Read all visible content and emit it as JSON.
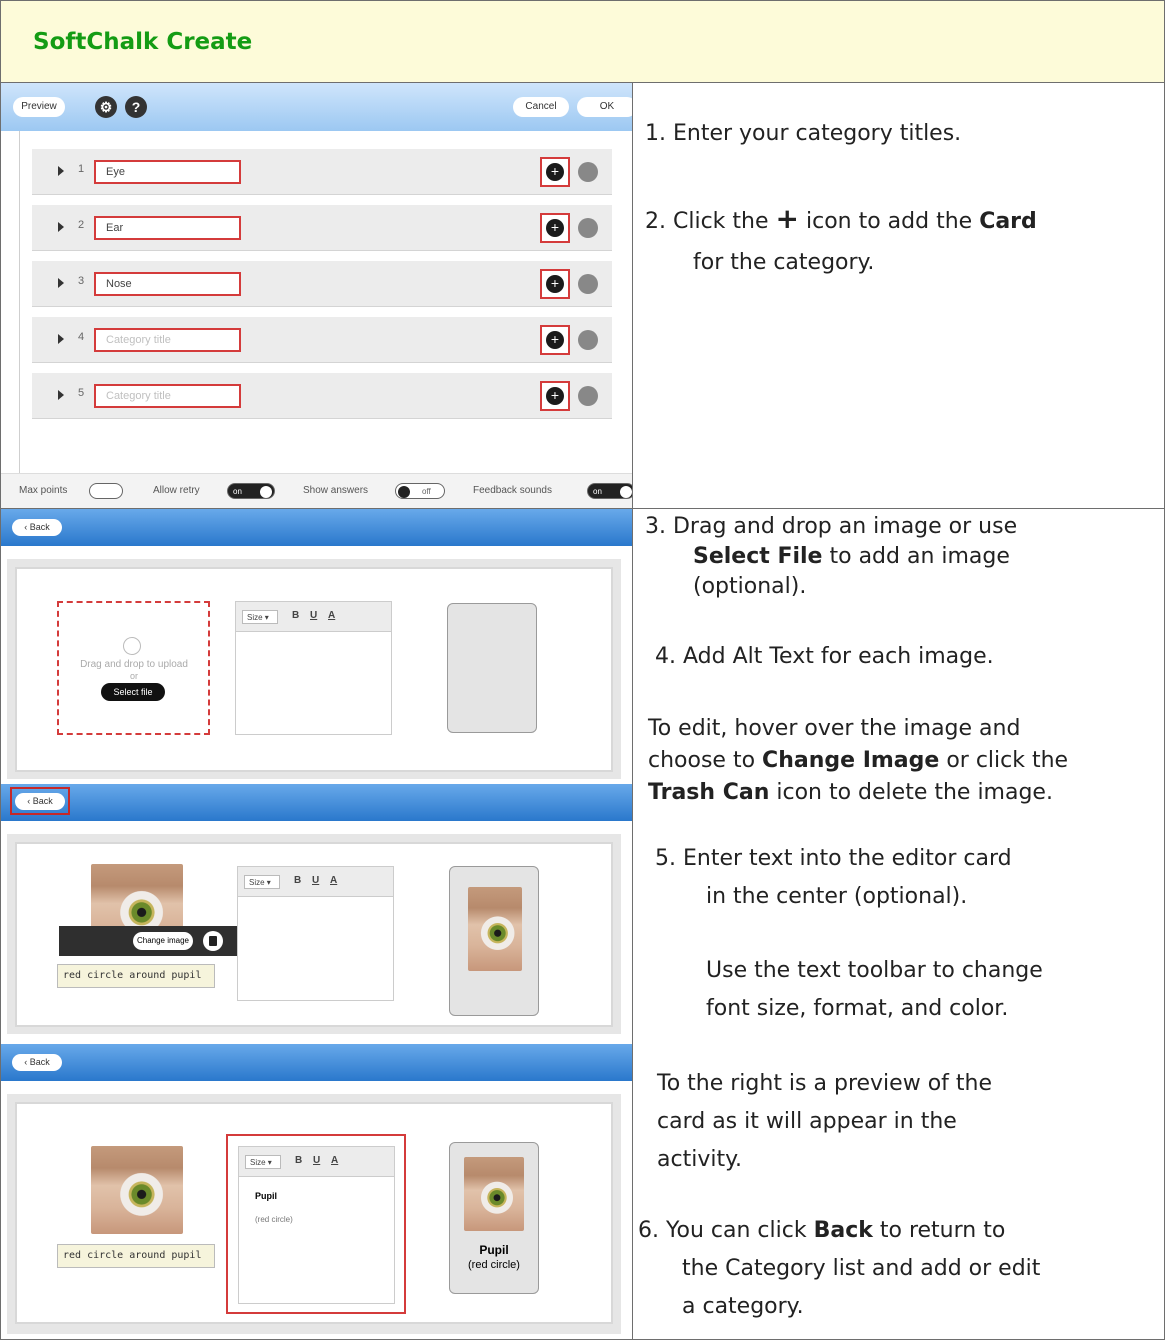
{
  "header": {
    "title": "SoftChalk Create"
  },
  "screen1": {
    "preview_label": "Preview",
    "cancel_label": "Cancel",
    "ok_label": "OK",
    "gear_glyph": "⚙",
    "help_glyph": "?",
    "categories": [
      {
        "num": "1",
        "value": "Eye",
        "placeholder": false
      },
      {
        "num": "2",
        "value": "Ear",
        "placeholder": false
      },
      {
        "num": "3",
        "value": "Nose",
        "placeholder": false
      },
      {
        "num": "4",
        "value": "Category title",
        "placeholder": true
      },
      {
        "num": "5",
        "value": "Category title",
        "placeholder": true
      }
    ],
    "footer": {
      "max_points": "Max points",
      "allow_retry": "Allow retry",
      "allow_retry_state": "on",
      "show_answers": "Show answers",
      "show_answers_state": "off",
      "feedback_sounds": "Feedback sounds",
      "feedback_sounds_state": "on"
    }
  },
  "editor": {
    "back_label": "‹ Back",
    "size_label": "Size",
    "bold": "B",
    "underline": "U",
    "color": "A",
    "drop_text": "Drag and drop to upload",
    "or_text": "or",
    "select_file": "Select file",
    "change_image": "Change image",
    "alt_text": "red circle around pupil",
    "card_title": "Pupil",
    "card_sub": "(red circle)"
  },
  "instructions": {
    "step1": "1.  Enter your category titles.",
    "step2_a": "2.  Click the",
    "step2_icon": "+",
    "step2_b": "icon to add the",
    "step2_bold": "Card",
    "step2_c": "for the category.",
    "step3_a": "3.  Drag and drop an image or use",
    "step3_bold": "Select File",
    "step3_b": "to add an image",
    "step3_c": "(optional).",
    "step4": "4.  Add Alt Text for each image.",
    "edit_a": "To edit, hover over the image and",
    "edit_b": "choose to",
    "edit_bold1": "Change Image",
    "edit_c": "or click the",
    "edit_bold2": "Trash Can",
    "edit_d": "icon to delete the image.",
    "step5_a": "5.  Enter text into the editor card",
    "step5_b": "in the center (optional).",
    "toolbar_a": "Use the text toolbar to change",
    "toolbar_b": "font size, format, and color.",
    "preview_a": "To the right is a preview of the",
    "preview_b": "card as it will appear in the",
    "preview_c": "activity.",
    "step6_a": "6.  You can click",
    "step6_bold": "Back",
    "step6_b": "to return to",
    "step6_c": "the Category list and add or edit",
    "step6_d": "a category."
  }
}
